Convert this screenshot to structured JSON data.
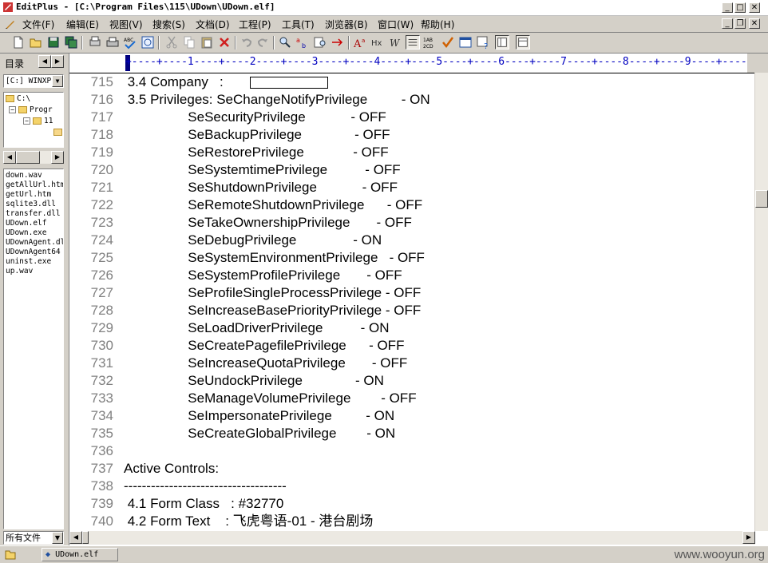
{
  "window": {
    "title": "EditPlus - [C:\\Program Files\\115\\UDown\\UDown.elf]",
    "min_label": "_",
    "max_label": "□",
    "close_label": "✕",
    "doc_min_label": "_",
    "doc_restore_label": "❐",
    "doc_close_label": "✕"
  },
  "menu": [
    "文件(F)",
    "编辑(E)",
    "视图(V)",
    "搜索(S)",
    "文档(D)",
    "工程(P)",
    "工具(T)",
    "浏览器(B)",
    "窗口(W)",
    "帮助(H)"
  ],
  "sidebar": {
    "dir_label": "目录",
    "drive": "[C:] WINXP",
    "tree": [
      {
        "label": "C:\\",
        "indent": 0
      },
      {
        "label": "Progr",
        "indent": 1
      },
      {
        "label": "11",
        "indent": 2
      },
      {
        "label": "",
        "indent": 3
      }
    ],
    "files": [
      "down.wav",
      "getAllUrl.htm",
      "getUrl.htm",
      "sqlite3.dll",
      "transfer.dll",
      "UDown.elf",
      "UDown.exe",
      "UDownAgent.dll",
      "UDownAgent64",
      "uninst.exe",
      "up.wav"
    ],
    "filter": "所有文件"
  },
  "editor": {
    "ruler": "+----+----1----+----2----+----3----+----4----+----5----+----6----+----7----+----8----+----9----+----",
    "lines": [
      {
        "num": "715",
        "text": " 3.4 Company   : ",
        "redacted": true
      },
      {
        "num": "716",
        "text": " 3.5 Privileges: SeChangeNotifyPrivilege         - ON"
      },
      {
        "num": "717",
        "text": "                 SeSecurityPrivilege            - OFF"
      },
      {
        "num": "718",
        "text": "                 SeBackupPrivilege              - OFF"
      },
      {
        "num": "719",
        "text": "                 SeRestorePrivilege             - OFF"
      },
      {
        "num": "720",
        "text": "                 SeSystemtimePrivilege          - OFF"
      },
      {
        "num": "721",
        "text": "                 SeShutdownPrivilege            - OFF"
      },
      {
        "num": "722",
        "text": "                 SeRemoteShutdownPrivilege      - OFF"
      },
      {
        "num": "723",
        "text": "                 SeTakeOwnershipPrivilege       - OFF"
      },
      {
        "num": "724",
        "text": "                 SeDebugPrivilege               - ON"
      },
      {
        "num": "725",
        "text": "                 SeSystemEnvironmentPrivilege   - OFF"
      },
      {
        "num": "726",
        "text": "                 SeSystemProfilePrivilege       - OFF"
      },
      {
        "num": "727",
        "text": "                 SeProfileSingleProcessPrivilege - OFF"
      },
      {
        "num": "728",
        "text": "                 SeIncreaseBasePriorityPrivilege - OFF"
      },
      {
        "num": "729",
        "text": "                 SeLoadDriverPrivilege          - ON"
      },
      {
        "num": "730",
        "text": "                 SeCreatePagefilePrivilege      - OFF"
      },
      {
        "num": "731",
        "text": "                 SeIncreaseQuotaPrivilege       - OFF"
      },
      {
        "num": "732",
        "text": "                 SeUndockPrivilege              - ON"
      },
      {
        "num": "733",
        "text": "                 SeManageVolumePrivilege        - OFF"
      },
      {
        "num": "734",
        "text": "                 SeImpersonatePrivilege         - ON"
      },
      {
        "num": "735",
        "text": "                 SeCreateGlobalPrivilege        - ON"
      },
      {
        "num": "736",
        "text": ""
      },
      {
        "num": "737",
        "text": "Active Controls:"
      },
      {
        "num": "738",
        "text": "------------------------------------"
      },
      {
        "num": "739",
        "text": " 4.1 Form Class   : #32770"
      },
      {
        "num": "740",
        "text": " 4.2 Form Text    : 飞虎粤语-01 - 港台剧场"
      }
    ]
  },
  "status": {
    "doc_tab": "UDown.elf",
    "watermark": "www.wooyun.org"
  }
}
